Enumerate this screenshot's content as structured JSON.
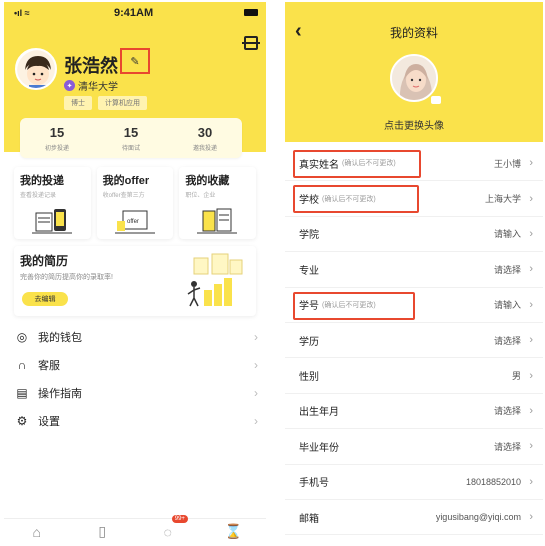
{
  "left": {
    "status": {
      "signal": "•ıl ≈",
      "time": "9:41AM"
    },
    "profile": {
      "name": "张浩然",
      "school": "清华大学",
      "tags": [
        "博士",
        "计算机应用"
      ]
    },
    "stats": [
      {
        "num": "15",
        "label": "初步投递"
      },
      {
        "num": "15",
        "label": "待面试"
      },
      {
        "num": "30",
        "label": "邀我投递"
      }
    ],
    "cards": [
      {
        "title": "我的投递",
        "sub": "查看投递记录"
      },
      {
        "title": "我的offer",
        "sub": "收offer查第三方"
      },
      {
        "title": "我的收藏",
        "sub": "职位、企业"
      }
    ],
    "resume": {
      "title": "我的简历",
      "sub": "完善你的简历提高你的录取率!",
      "button": "去编辑"
    },
    "menu": [
      {
        "icon": "wallet-icon",
        "label": "我的钱包"
      },
      {
        "icon": "headset-icon",
        "label": "客服"
      },
      {
        "icon": "guide-icon",
        "label": "操作指南"
      },
      {
        "icon": "gear-icon",
        "label": "设置"
      }
    ],
    "tabbar": {
      "badge": "99+"
    }
  },
  "right": {
    "title": "我的资料",
    "change_avatar": "点击更换头像",
    "rows": [
      {
        "label": "真实姓名",
        "note": "(确认后不可更改)",
        "value": "王小博"
      },
      {
        "label": "学校",
        "note": "(确认后不可更改)",
        "value": "上海大学"
      },
      {
        "label": "学院",
        "note": "",
        "value": "请输入"
      },
      {
        "label": "专业",
        "note": "",
        "value": "请选择"
      },
      {
        "label": "学号",
        "note": "(确认后不可更改)",
        "value": "请输入"
      },
      {
        "label": "学历",
        "note": "",
        "value": "请选择"
      },
      {
        "label": "性别",
        "note": "",
        "value": "男"
      },
      {
        "label": "出生年月",
        "note": "",
        "value": "请选择"
      },
      {
        "label": "毕业年份",
        "note": "",
        "value": "请选择"
      },
      {
        "label": "手机号",
        "note": "",
        "value": "18018852010"
      },
      {
        "label": "邮箱",
        "note": "",
        "value": "yigusibang@yiqi.com"
      }
    ]
  },
  "colors": {
    "accent": "#fae24b",
    "highlight": "#e8482f"
  }
}
